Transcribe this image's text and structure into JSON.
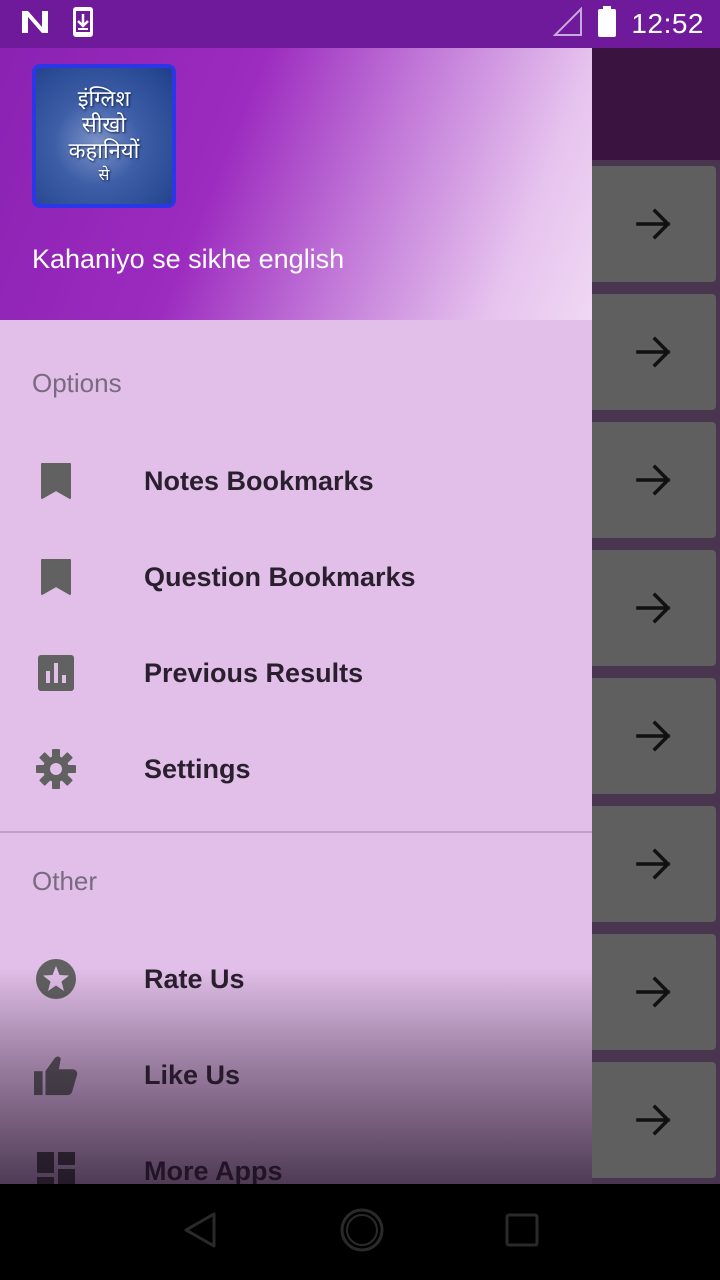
{
  "status_bar": {
    "time": "12:52",
    "icons": [
      "notification-n-icon",
      "download-icon",
      "signal-icon",
      "battery-icon"
    ]
  },
  "drawer": {
    "header": {
      "logo_lines": [
        "इंग्लिश",
        "सीखो",
        "कहानियों",
        "से"
      ],
      "title": "Kahaniyo se sikhe english"
    },
    "sections": [
      {
        "label": "Options",
        "items": [
          {
            "label": "Notes Bookmarks",
            "icon": "bookmark-icon"
          },
          {
            "label": "Question Bookmarks",
            "icon": "bookmark-icon"
          },
          {
            "label": "Previous Results",
            "icon": "bar-chart-icon"
          },
          {
            "label": "Settings",
            "icon": "gear-icon"
          }
        ]
      },
      {
        "label": "Other",
        "items": [
          {
            "label": "Rate Us",
            "icon": "star-circle-icon"
          },
          {
            "label": "Like Us",
            "icon": "thumbs-up-icon"
          },
          {
            "label": "More Apps",
            "icon": "dashboard-icon"
          }
        ]
      }
    ]
  },
  "background_list": {
    "card_icon": "arrow-right-icon",
    "card_count": 8
  },
  "colors": {
    "status_bar": "#6e1a9a",
    "drawer_bg": "#e1bfe8",
    "header_start": "#8a22b2",
    "icon_gray": "#616161"
  },
  "nav_bar": {
    "icons": [
      "back-icon",
      "home-icon",
      "recents-icon"
    ]
  }
}
